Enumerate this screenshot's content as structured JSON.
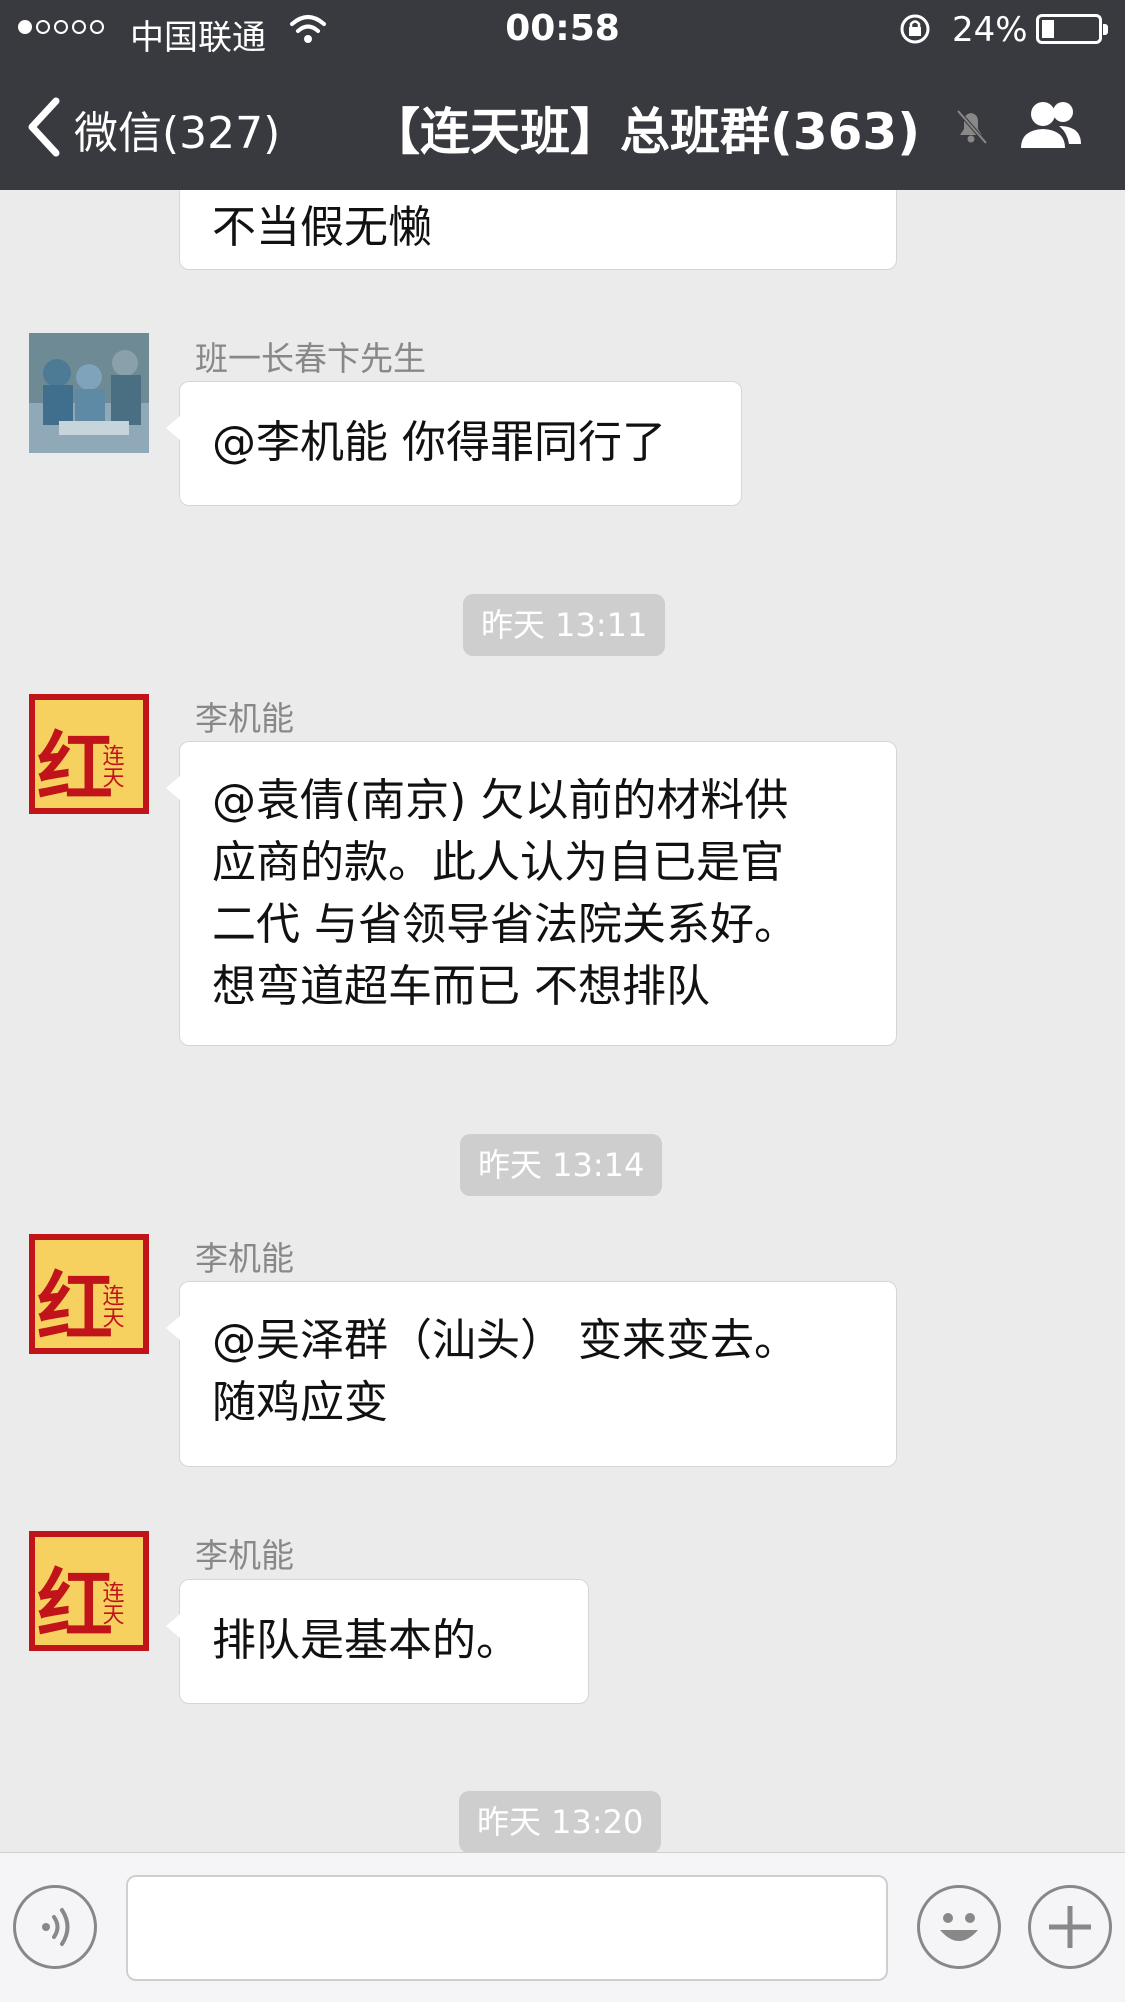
{
  "status_bar": {
    "carrier": "中国联通",
    "time": "00:58",
    "battery_percent": "24%",
    "battery_level": 0.24,
    "signal_bars_filled": 1,
    "signal_bars_total": 5
  },
  "nav": {
    "back_label": "微信(327)",
    "title": "【连天班】总班群(363)"
  },
  "messages": [
    {
      "type": "text",
      "text": "不当假无懒",
      "partial": true
    },
    {
      "type": "msg",
      "sender": "班一长春卞先生",
      "avatar": "surgery-photo-avatar",
      "lines": [
        "@李机能 你得罪同行了"
      ]
    },
    {
      "type": "time",
      "text": "昨天 13:11"
    },
    {
      "type": "msg",
      "sender": "李机能",
      "avatar": "red-calligraphy-avatar",
      "lines": [
        "@袁倩(南京) 欠以前的材料供",
        "应商的款。此人认为自已是官",
        "二代 与省领导省法院关系好。",
        "想弯道超车而已  不想排队"
      ]
    },
    {
      "type": "time",
      "text": "昨天 13:14"
    },
    {
      "type": "msg",
      "sender": "李机能",
      "avatar": "red-calligraphy-avatar",
      "lines": [
        "@吴泽群（汕头） 变来变去。",
        "随鸡应变"
      ]
    },
    {
      "type": "msg",
      "sender": "李机能",
      "avatar": "red-calligraphy-avatar",
      "lines": [
        "排队是基本的。"
      ]
    },
    {
      "type": "time",
      "text": "昨天 13:20"
    }
  ],
  "avatar_art": {
    "calligraphy": "红",
    "calligraphy_small": "连天"
  },
  "input_bar": {
    "voice_icon": "voice-icon",
    "emoji_icon": "emoji-icon",
    "plus_icon": "plus-icon",
    "value": ""
  },
  "colors": {
    "nav_bg": "#393a3f",
    "chat_bg": "#ebebeb",
    "bubble_bg": "#ffffff",
    "time_bg": "#cecece",
    "avatar_red": "#c0141a"
  }
}
